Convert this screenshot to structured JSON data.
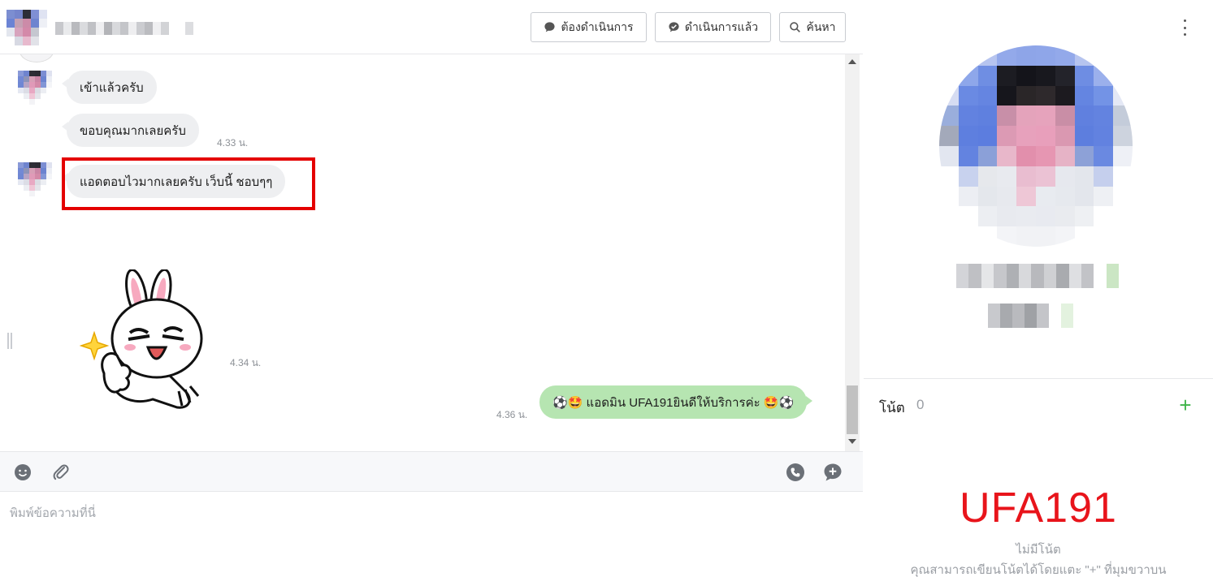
{
  "header": {
    "buttons": {
      "pending_label": "ต้องดำเนินการ",
      "done_label": "ดำเนินการแล้ว",
      "search_label": "ค้นหา"
    }
  },
  "messages": [
    {
      "direction": "in",
      "text": "เข้าแล้วครับ",
      "time": ""
    },
    {
      "direction": "in",
      "text": "ขอบคุณมากเลยครับ",
      "time": "4.33 น."
    },
    {
      "direction": "in",
      "text": "แอดตอบไวมากเลยครับ เว็บนี้ ชอบๆๆ",
      "time": "",
      "highlighted": true
    },
    {
      "direction": "in",
      "type": "sticker",
      "sticker": "cony-thumbs-up-sticker",
      "time": "4.34 น."
    },
    {
      "direction": "out",
      "text": "⚽🤩 แอดมิน UFA191ยินดีให้บริการค่ะ 🤩⚽",
      "time": "4.36 น."
    }
  ],
  "compose": {
    "placeholder": "พิมพ์ข้อความที่นี่"
  },
  "toolbar": {
    "icons": [
      "emoji-icon",
      "attachment-icon",
      "phone-icon",
      "add-chat-icon"
    ]
  },
  "profile": {
    "notes_label": "โน้ต",
    "notes_count": "0",
    "brand": "UFA191",
    "no_notes": "ไม่มีโน้ต",
    "no_notes_hint": "คุณสามารถเขียนโน้ตได้โดยแตะ \"+\" ที่มุมขวาบน"
  },
  "colors": {
    "outgoing_bubble": "#b6e5b1",
    "incoming_bubble": "#eeeff1",
    "highlight": "#e40000",
    "brand": "#e8141b",
    "add_button": "#3fb449"
  }
}
